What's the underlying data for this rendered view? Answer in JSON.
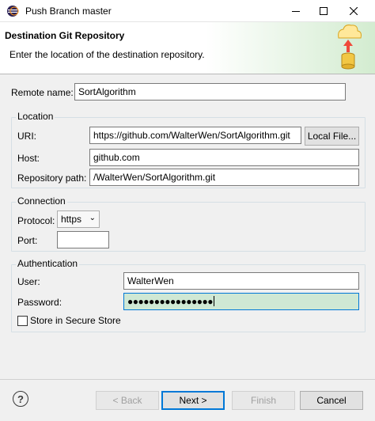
{
  "window": {
    "title": "Push Branch master"
  },
  "header": {
    "title": "Destination Git Repository",
    "description": "Enter the location of the destination repository."
  },
  "remote": {
    "label": "Remote name:",
    "value": "SortAlgorithm"
  },
  "location": {
    "group_title": "Location",
    "uri_label": "URI:",
    "uri_value": "https://github.com/WalterWen/SortAlgorithm.git",
    "local_file_label": "Local File...",
    "host_label": "Host:",
    "host_value": "github.com",
    "repo_path_label": "Repository path:",
    "repo_path_value": "/WalterWen/SortAlgorithm.git"
  },
  "connection": {
    "group_title": "Connection",
    "protocol_label": "Protocol:",
    "protocol_value": "https",
    "port_label": "Port:",
    "port_value": ""
  },
  "authentication": {
    "group_title": "Authentication",
    "user_label": "User:",
    "user_value": "WalterWen",
    "password_label": "Password:",
    "password_value": "●●●●●●●●●●●●●●●●",
    "store_label": "Store in Secure Store",
    "store_checked": false
  },
  "footer": {
    "help_label": "?",
    "back_label": "< Back",
    "next_label": "Next >",
    "finish_label": "Finish",
    "cancel_label": "Cancel"
  },
  "icons": {
    "app": "eclipse-icon",
    "wizard": "git-push-icon",
    "minimize": "minimize-icon",
    "maximize": "maximize-icon",
    "close": "close-icon"
  }
}
